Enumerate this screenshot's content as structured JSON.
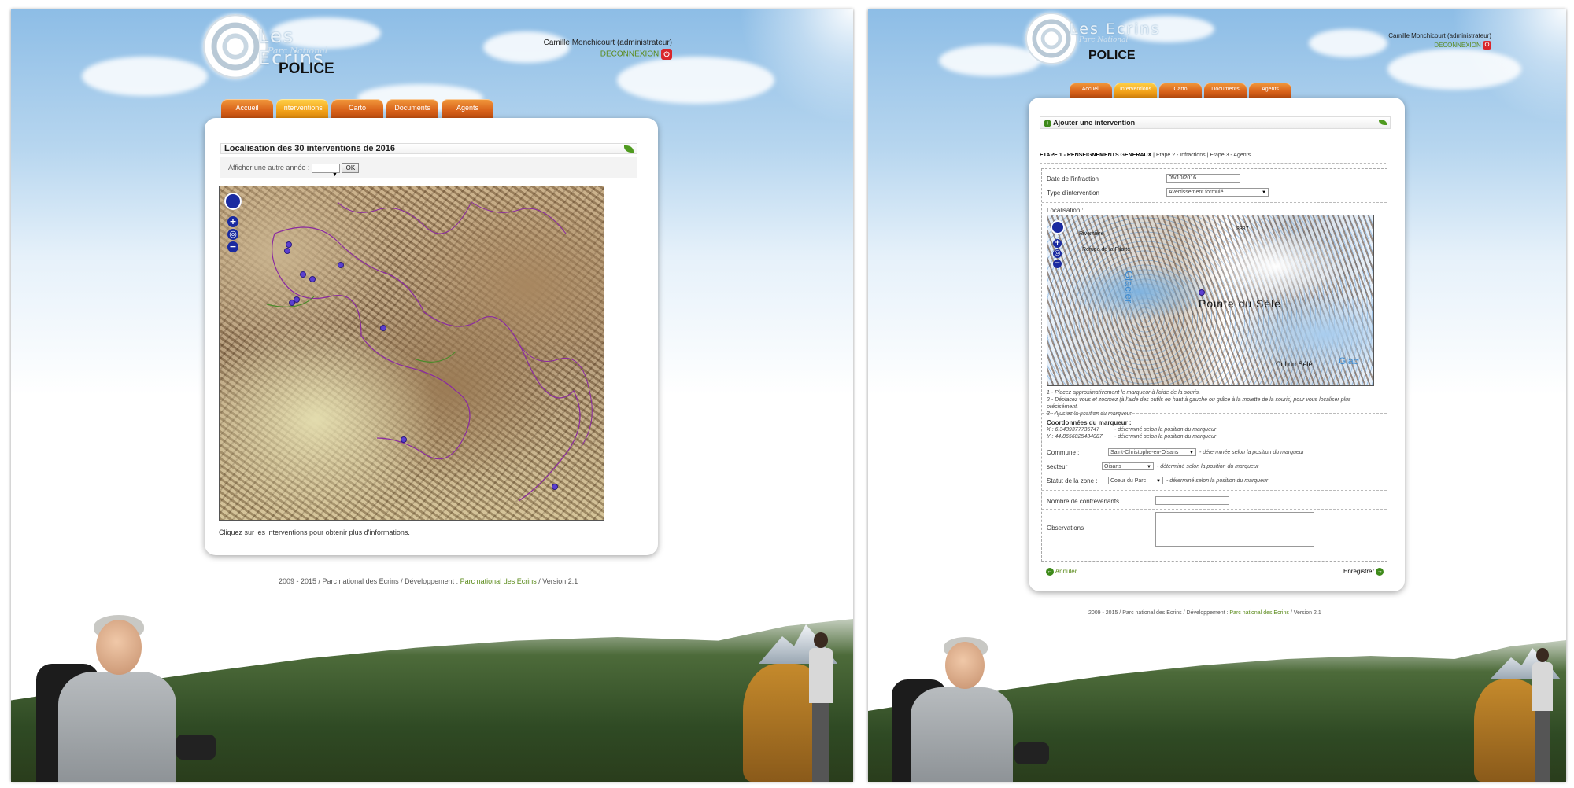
{
  "left": {
    "header": {
      "brand": "Les Ecrins",
      "brand_sub": "Parc National",
      "app_title": "POLICE",
      "user_name": "Camille Monchicourt (administrateur)",
      "logout_label": "DECONNEXION"
    },
    "tabs": [
      "Accueil",
      "Interventions",
      "Carto",
      "Documents",
      "Agents"
    ],
    "active_tab": "Interventions",
    "card": {
      "title": "Localisation des 30 interventions de 2016",
      "year_label": "Afficher une autre année :",
      "year_value": "",
      "ok_label": "OK",
      "hint": "Cliquez sur les interventions pour obtenir plus d'informations."
    },
    "footer": {
      "text": "2009 - 2015 / Parc national des Ecrins / Développement :",
      "link": "Parc national des Ecrins",
      "version": "/ Version 2.1"
    }
  },
  "right": {
    "header": {
      "brand": "Les Ecrins",
      "brand_sub": "Parc National",
      "app_title": "POLICE",
      "user_name": "Camille Monchicourt (administrateur)",
      "logout_label": "DECONNEXION"
    },
    "tabs": [
      "Accueil",
      "Interventions",
      "Carto",
      "Documents",
      "Agents"
    ],
    "active_tab": "Interventions",
    "card": {
      "title": "Ajouter une intervention",
      "step1": "ETAPE 1 - RENSEIGNEMENTS GENERAUX",
      "step2": "Etape 2 - Infractions",
      "step3": "Etape 3 - Agents",
      "date_label": "Date de l'infraction",
      "date_value": "05/10/2016",
      "type_label": "Type d'intervention",
      "type_value": "Avertissement formulé",
      "location_label": "Localisation :",
      "map_labels": {
        "peak": "Pointe du Sélé",
        "col": "Col du Sélé",
        "glacier": "Glacier",
        "refuge": "Refuge de la Pilatte",
        "elev": "3337",
        "alt": "Rivemière",
        "glac2": "Glac"
      },
      "instructions": [
        "1 - Placez approximativement le marqueur à l'aide de la souris.",
        "2 - Déplacez vous et zoomez (à l'aide des outils en haut à gauche ou grâce à la molette de la souris) pour vous localiser plus précisément.",
        "3 - Ajustez la position du marqueur."
      ],
      "coords_label": "Coordonnées du marqueur :",
      "x_value": "X : 6.3439377735747",
      "y_value": "Y : 44.8656825434087",
      "coord_note": "- déterminé selon la position du marqueur",
      "commune_label": "Commune :",
      "commune_value": "Saint-Christophe-en-Oisans",
      "commune_note": "- déterminée selon la position du marqueur",
      "secteur_label": "secteur :",
      "secteur_value": "Oisans",
      "secteur_note": "- déterminé selon la position du marqueur",
      "zone_label": "Statut de la zone :",
      "zone_value": "Coeur du Parc",
      "zone_note": "- déterminé selon la position du marqueur",
      "contrevenants_label": "Nombre de contrevenants",
      "contrevenants_value": "",
      "observations_label": "Observations",
      "cancel_label": "Annuler",
      "save_label": "Enregistrer"
    },
    "footer": {
      "text": "2009 - 2015 / Parc national des Ecrins / Développement :",
      "link": "Parc national des Ecrins",
      "version": "/ Version 2.1"
    }
  }
}
